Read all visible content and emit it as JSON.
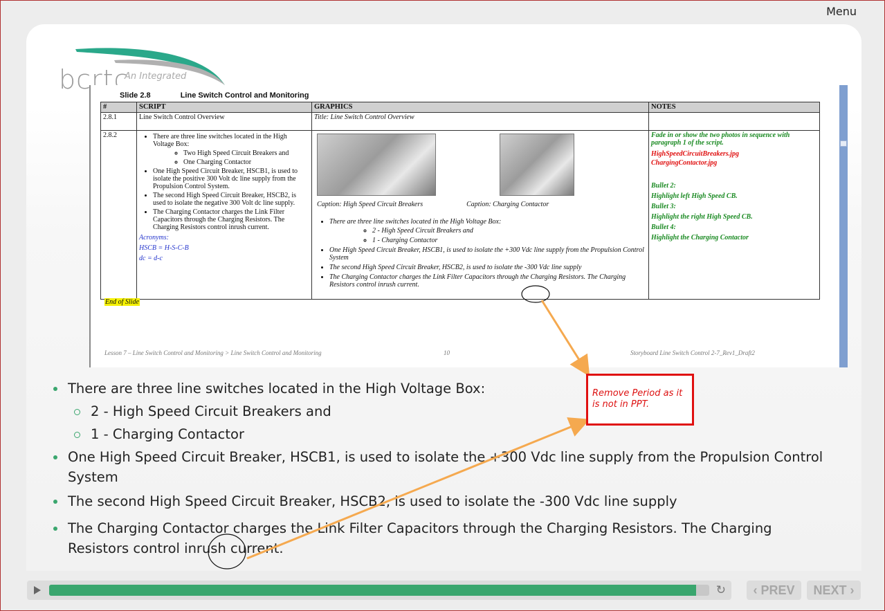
{
  "header": {
    "menu_label": "Menu"
  },
  "logo": {
    "text": "bcrtc",
    "tagline": "An Integrated"
  },
  "doc": {
    "slide_number": "Slide 2.8",
    "slide_title": "Line Switch Control and Monitoring",
    "columns": [
      "#",
      "SCRIPT",
      "GRAPHICS",
      "NOTES"
    ],
    "row1": {
      "num": "2.8.1",
      "script": "Line Switch Control Overview",
      "graphics": "Title: Line Switch Control Overview"
    },
    "row2": {
      "num": "2.8.2",
      "script_items": [
        "There are three line switches located in the High Voltage Box:",
        "One High Speed Circuit Breaker, HSCB1, is used to isolate the positive 300 Volt dc line supply from the Propulsion Control System.",
        "The second High Speed Circuit Breaker, HSCB2, is used to isolate the negative 300 Volt dc line supply.",
        "The Charging Contactor charges the Link Filter Capacitors through the Charging Resistors. The Charging Resistors control inrush current."
      ],
      "script_sub_items": [
        "Two High Speed Circuit Breakers and",
        "One Charging Contactor"
      ],
      "acronyms_label": "Acronyms:",
      "acronyms": [
        "HSCB = H-S-C-B",
        "dc = d-c"
      ],
      "caption_a": "Caption: High Speed Circuit Breakers",
      "caption_b": "Caption: Charging Contactor",
      "graphics_items": [
        "There are three line switches located in the High Voltage Box:",
        "One High Speed Circuit Breaker, HSCB1, is used to isolate the +300 Vdc line supply from the Propulsion Control System",
        "The second High Speed Circuit Breaker, HSCB2, is used to isolate the -300 Vdc line supply",
        "The Charging Contactor charges the Link Filter Capacitors through the Charging Resistors. The Charging Resistors control inrush current."
      ],
      "graphics_sub_items": [
        "2 - High Speed Circuit Breakers and",
        "1 - Charging Contactor"
      ],
      "notes": {
        "intro": "Fade in or show the two photos in sequence with paragraph 1 of the script.",
        "file_a": "HighSpeedCircuitBreakers.jpg",
        "file_b": "ChargingContactor.jpg",
        "b2_label": "Bullet 2:",
        "b2_text": "Highlight left High Speed CB.",
        "b3_label": "Bullet 3:",
        "b3_text": "Highlight the right High Speed CB.",
        "b4_label": "Bullet 4:",
        "b4_text": "Highlight the Charging Contactor"
      }
    },
    "end_of_slide": "End of Slide",
    "footer": {
      "left": "Lesson 7 – Line Switch Control and Monitoring > Line Switch Control and Monitoring",
      "page": "10",
      "right": "Storyboard Line Switch Control 2-7_Rev1_Draft2"
    }
  },
  "bullets": {
    "b1": "There are three line switches located in the High Voltage Box:",
    "b1_sub1": "2 - High Speed Circuit Breakers and",
    "b1_sub2": "1 - Charging Contactor",
    "b2": "One High Speed Circuit Breaker, HSCB1, is used to isolate the +300 Vdc line supply from the Propulsion Control System",
    "b3": "The second High Speed Circuit Breaker, HSCB2, is used to isolate the -300 Vdc line supply",
    "b4": "The Charging Contactor charges the Link Filter Capacitors through the Charging Resistors. The Charging Resistors control inrush current."
  },
  "callout": {
    "text": "Remove Period as it is not in PPT."
  },
  "player": {
    "progress": 0.98
  },
  "nav": {
    "prev_label": "‹ PREV",
    "next_label": "NEXT ›"
  },
  "colors": {
    "accent_green": "#3aa66e",
    "callout_red": "#e01010",
    "arrow_orange": "#f5a94f"
  }
}
